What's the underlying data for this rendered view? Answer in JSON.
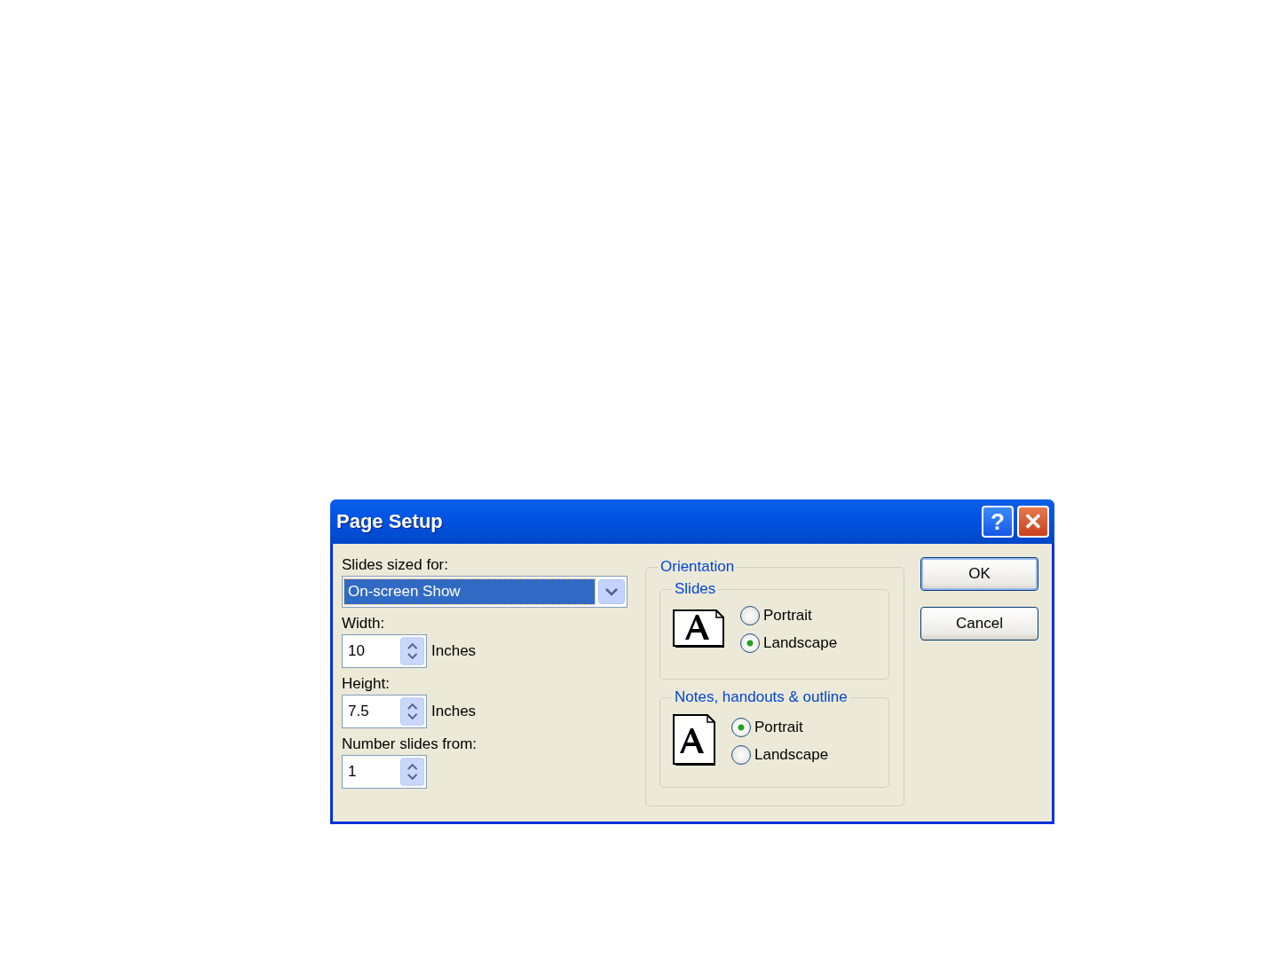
{
  "window": {
    "title": "Page Setup",
    "title_buttons": [
      {
        "kind": "help",
        "label": "?"
      },
      {
        "kind": "close",
        "label": "✕"
      }
    ]
  },
  "size": {
    "label": "Slides sized for:",
    "value": "On-screen Show"
  },
  "fields": [
    {
      "label": "Width:",
      "value": "10",
      "unit": "Inches"
    },
    {
      "label": "Height:",
      "value": "7.5",
      "unit": "Inches"
    },
    {
      "label": "Number slides from:",
      "value": "1"
    }
  ],
  "orientation": {
    "title": "Orientation",
    "groups": [
      {
        "title": "Slides",
        "kind": "landscape",
        "options": [
          {
            "label": "Portrait",
            "selected": false
          },
          {
            "label": "Landscape",
            "selected": true
          }
        ]
      },
      {
        "title": "Notes, handouts & outline",
        "kind": "portrait",
        "options": [
          {
            "label": "Portrait",
            "selected": true
          },
          {
            "label": "Landscape",
            "selected": false
          }
        ]
      }
    ]
  },
  "buttons": [
    {
      "label": "OK",
      "default": true
    },
    {
      "label": "Cancel",
      "default": false
    }
  ]
}
